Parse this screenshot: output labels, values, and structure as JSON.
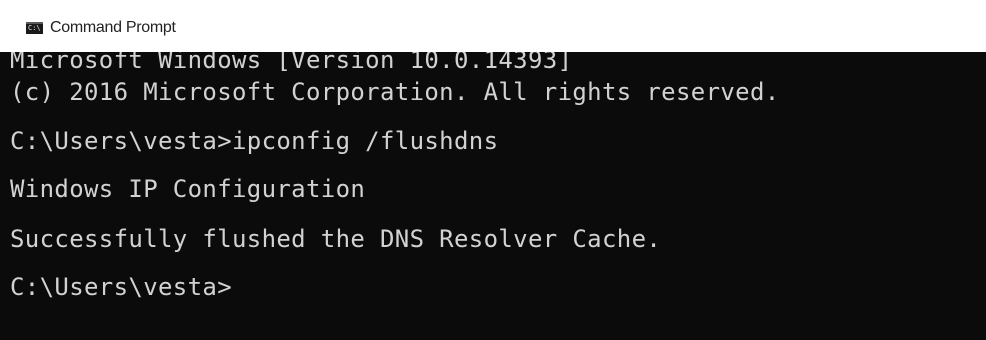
{
  "window": {
    "title": "Command Prompt",
    "icon": "command-prompt-icon",
    "icon_glyph": "C:\\"
  },
  "console": {
    "background": "#0b0b0b",
    "foreground": "#d2d2d2",
    "lines": [
      "Microsoft Windows [Version 10.0.14393]",
      "(c) 2016 Microsoft Corporation. All rights reserved.",
      "C:\\Users\\vesta>ipconfig /flushdns",
      "Windows IP Configuration",
      "Successfully flushed the DNS Resolver Cache.",
      "C:\\Users\\vesta>"
    ]
  }
}
